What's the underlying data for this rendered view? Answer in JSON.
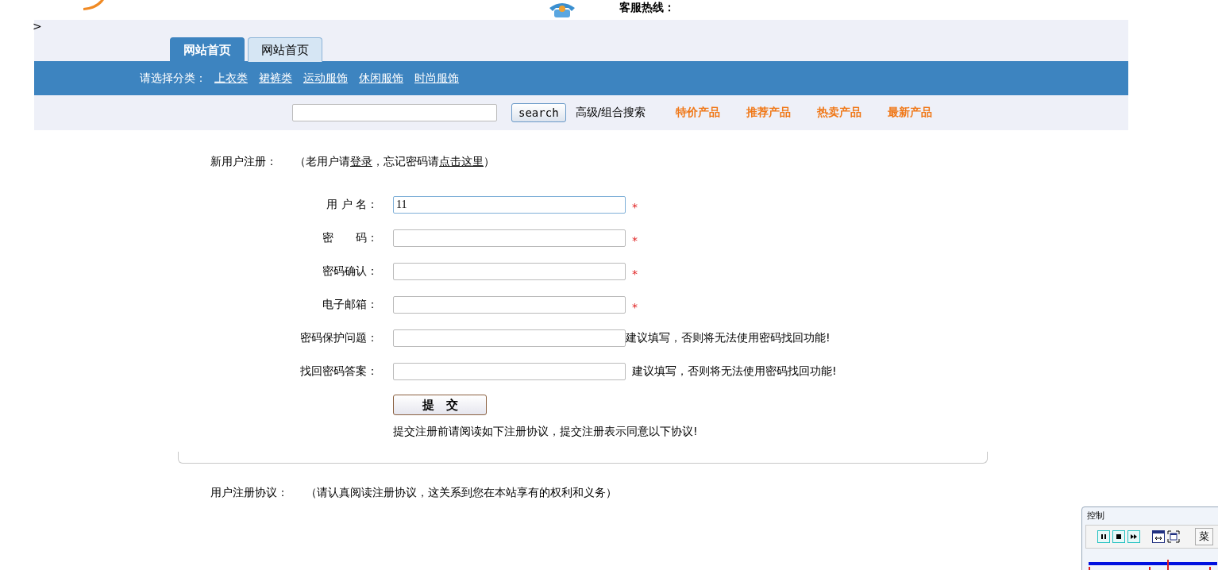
{
  "header": {
    "hotline_label": "客服热线："
  },
  "breadcrumb": ">",
  "tabs": [
    {
      "label": "网站首页",
      "selected": true
    },
    {
      "label": "网站首页",
      "selected": false
    }
  ],
  "category_bar": {
    "label": "请选择分类：",
    "links": [
      "上衣类",
      "裙裤类",
      "运动服饰",
      "休闲服饰",
      "时尚服饰"
    ]
  },
  "search": {
    "button": "search",
    "advanced_link": "高级/组合搜索",
    "product_links": [
      "特价产品",
      "推荐产品",
      "热卖产品",
      "最新产品"
    ]
  },
  "register": {
    "title": "新用户注册：",
    "note_parts": [
      {
        "text": "（老用户请",
        "link": false
      },
      {
        "text": "登录",
        "link": true
      },
      {
        "text": "，忘记密码请",
        "link": false
      },
      {
        "text": "点击这里",
        "link": true
      },
      {
        "text": "）",
        "link": false
      }
    ],
    "fields": [
      {
        "label": "用 户 名：",
        "value": "11",
        "required": true,
        "kind": "text"
      },
      {
        "label": "密　　码：",
        "required": true,
        "kind": "password"
      },
      {
        "label": "密码确认：",
        "required": true,
        "kind": "password"
      },
      {
        "label": "电子邮箱：",
        "required": true,
        "kind": "text"
      },
      {
        "label": "密码保护问题：",
        "required": false,
        "hint": "建议填写，否则将无法使用密码找回功能!",
        "kind": "text"
      },
      {
        "label": "找回密码答案：",
        "required": false,
        "hint": "建议填写，否则将无法使用密码找回功能!",
        "kind": "text"
      }
    ],
    "required_mark": "*",
    "submit": "提　交",
    "notice": "提交注册前请阅读如下注册协议，提交注册表示同意以下协议!"
  },
  "agreement": {
    "title": "用户注册协议：",
    "note": "（请认真阅读注册协议，这关系到您在本站享有的权利和义务）"
  },
  "control_panel": {
    "title": "控制",
    "menu_button": "菜"
  }
}
